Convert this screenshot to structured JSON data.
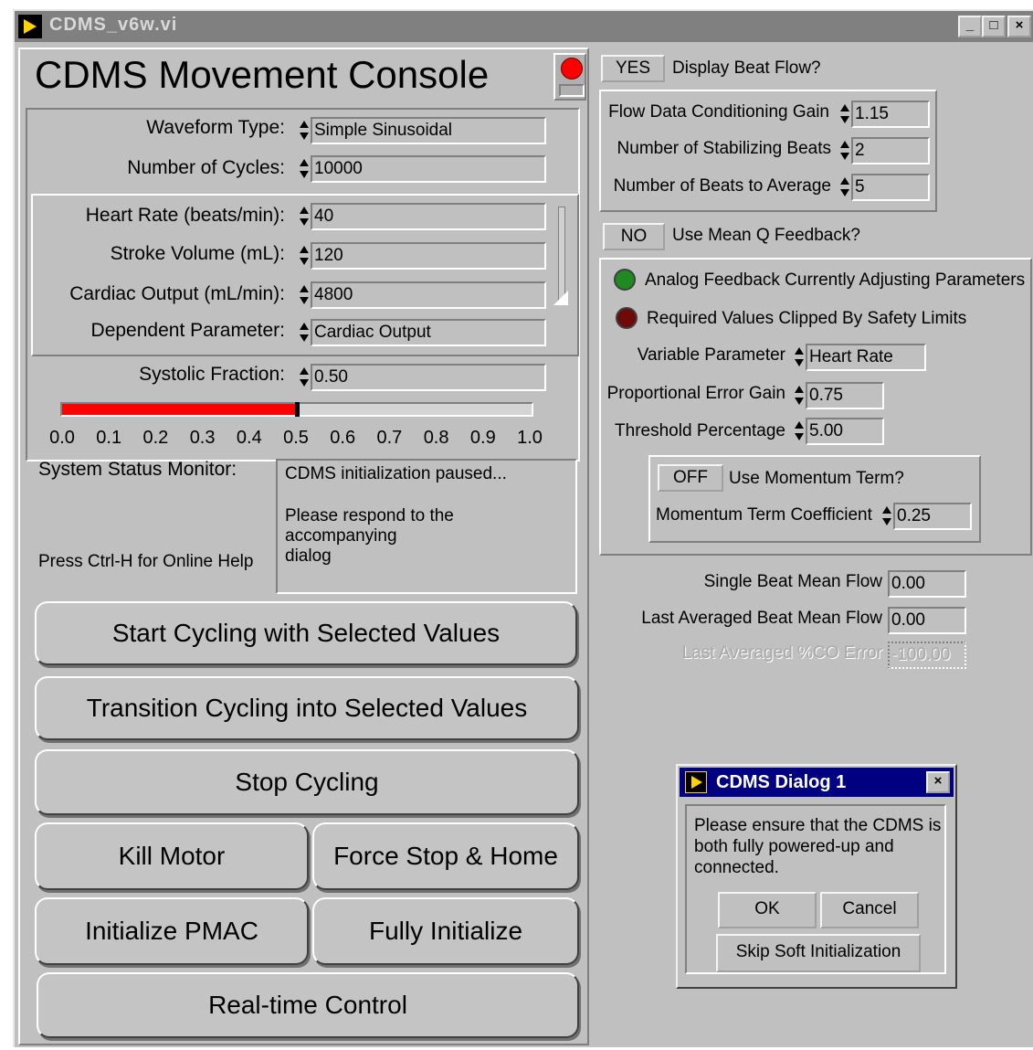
{
  "window": {
    "title": "CDMS_v6w.vi",
    "minimize_label": "_",
    "maximize_label": "□",
    "close_label": "×"
  },
  "console": {
    "title": "CDMS Movement Console",
    "waveform_type": {
      "label": "Waveform Type:",
      "value": "Simple Sinusoidal"
    },
    "num_cycles": {
      "label": "Number of Cycles:",
      "value": "10000"
    },
    "heart_rate": {
      "label": "Heart Rate (beats/min):",
      "value": "40"
    },
    "stroke_volume": {
      "label": "Stroke Volume (mL):",
      "value": "120"
    },
    "cardiac_output": {
      "label": "Cardiac Output (mL/min):",
      "value": "4800"
    },
    "dependent_parameter": {
      "label": "Dependent Parameter:",
      "value": "Cardiac Output"
    },
    "systolic_fraction": {
      "label": "Systolic Fraction:",
      "value": "0.50"
    },
    "slider": {
      "value": 0.5,
      "min": 0.0,
      "max": 1.0,
      "ticks": [
        "0.0",
        "0.1",
        "0.2",
        "0.3",
        "0.4",
        "0.5",
        "0.6",
        "0.7",
        "0.8",
        "0.9",
        "1.0"
      ],
      "fill_color": "#ff0000"
    },
    "status_label": "System Status Monitor:",
    "status_line1": "CDMS initialization paused...",
    "status_line2": "Please respond to the accompanying",
    "status_line3": "dialog",
    "help_text": "Press Ctrl-H for Online Help",
    "indicator_color": "#ff0000"
  },
  "buttons": {
    "start": "Start Cycling with Selected Values",
    "transition": "Transition Cycling into Selected Values",
    "stop": "Stop Cycling",
    "kill": "Kill Motor",
    "force_stop": "Force Stop & Home",
    "init_pmac": "Initialize PMAC",
    "fully_init": "Fully Initialize",
    "realtime": "Real-time Control"
  },
  "flow": {
    "display_toggle": "YES",
    "display_label": "Display Beat Flow?",
    "gain": {
      "label": "Flow Data Conditioning Gain",
      "value": "1.15"
    },
    "stabilizing": {
      "label": "Number of Stabilizing Beats",
      "value": "2"
    },
    "average": {
      "label": "Number of Beats to Average",
      "value": "5"
    }
  },
  "feedback": {
    "toggle": "NO",
    "label": "Use Mean Q Feedback?",
    "analog_led": {
      "label": "Analog Feedback Currently Adjusting Parameters",
      "color": "#1f8a1f"
    },
    "clipped_led": {
      "label": "Required Values Clipped By Safety Limits",
      "color": "#6e0a0a"
    },
    "variable_parameter": {
      "label": "Variable Parameter",
      "value": "Heart Rate"
    },
    "prop_gain": {
      "label": "Proportional Error Gain",
      "value": "0.75"
    },
    "threshold": {
      "label": "Threshold Percentage",
      "value": "5.00"
    },
    "momentum_toggle": "OFF",
    "momentum_label": "Use Momentum Term?",
    "momentum_coef": {
      "label": "Momentum Term Coefficient",
      "value": "0.25"
    }
  },
  "readouts": {
    "single": {
      "label": "Single Beat Mean Flow",
      "value": "0.00"
    },
    "averaged": {
      "label": "Last Averaged Beat Mean Flow",
      "value": "0.00"
    },
    "error": {
      "label": "Last Averaged %CO Error",
      "value": "-100.00"
    }
  },
  "dialog": {
    "title": "CDMS Dialog 1",
    "close_label": "×",
    "message": "Please ensure that the CDMS is both fully powered-up and connected.",
    "ok": "OK",
    "cancel": "Cancel",
    "skip": "Skip Soft Initialization",
    "title_color": "#000080"
  }
}
